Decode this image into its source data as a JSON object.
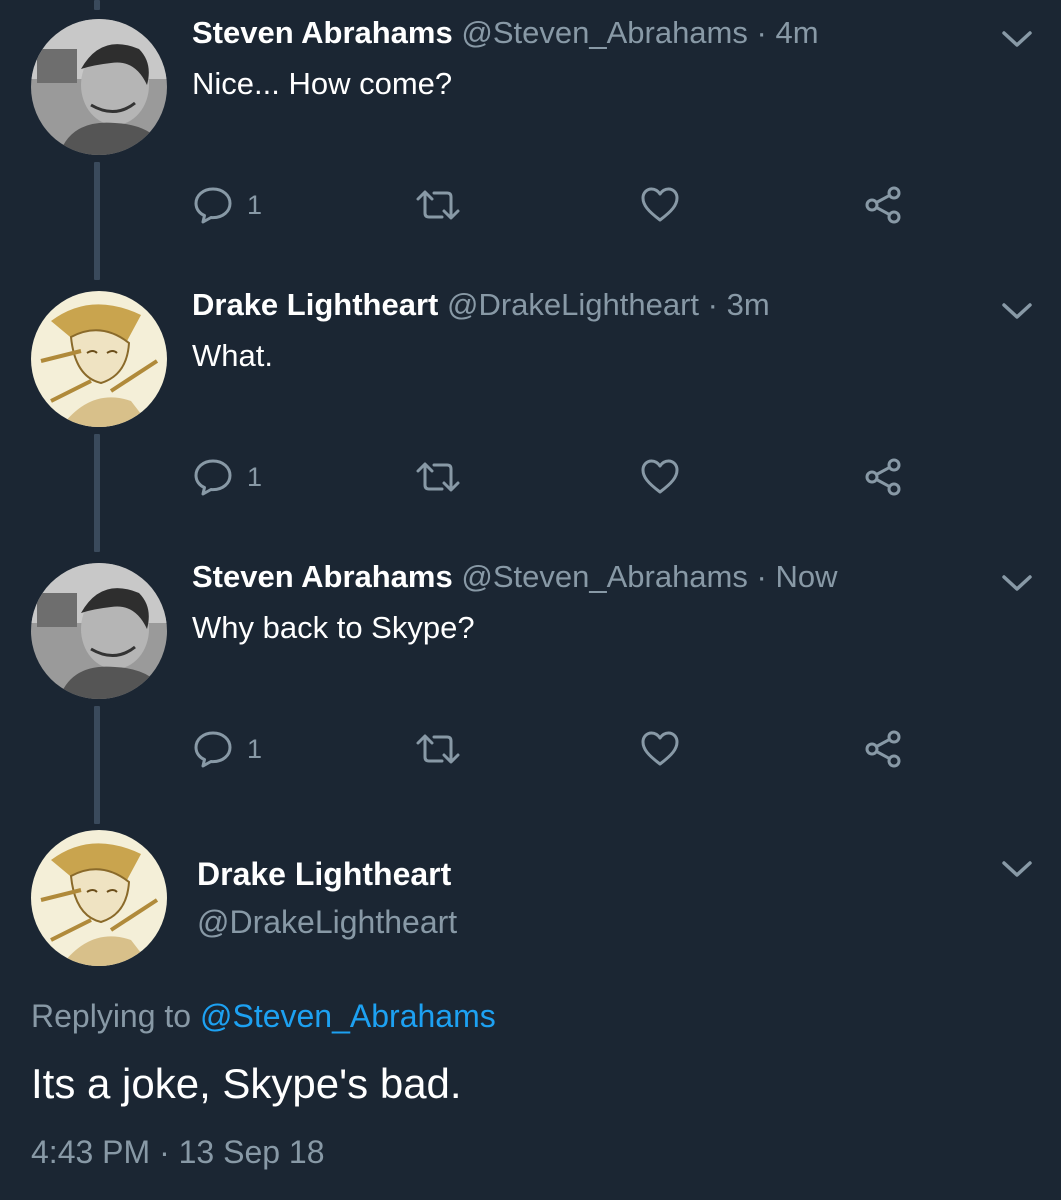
{
  "colors": {
    "background": "#1b2633",
    "secondary_text": "#8899a6",
    "link": "#1da1f2",
    "thread_line": "#3a4a5c"
  },
  "tweets": [
    {
      "name": "Steven Abrahams",
      "handle": "@Steven_Abrahams",
      "separator": "·",
      "time": "4m",
      "text": "Nice... How come?",
      "reply_count": "1",
      "avatar_icon": "avatar-photo-man"
    },
    {
      "name": "Drake Lightheart",
      "handle": "@DrakeLightheart",
      "separator": "·",
      "time": "3m",
      "text": "What.",
      "reply_count": "1",
      "avatar_icon": "avatar-drawing"
    },
    {
      "name": "Steven Abrahams",
      "handle": "@Steven_Abrahams",
      "separator": "·",
      "time": "Now",
      "text": "Why back to Skype?",
      "reply_count": "1",
      "avatar_icon": "avatar-photo-man"
    }
  ],
  "main_tweet": {
    "name": "Drake Lightheart",
    "handle": "@DrakeLightheart",
    "replying_prefix": "Replying to",
    "replying_to": "@Steven_Abrahams",
    "text": "Its a joke, Skype's bad.",
    "time": "4:43 PM",
    "separator": "·",
    "date": "13 Sep 18",
    "avatar_icon": "avatar-drawing"
  }
}
